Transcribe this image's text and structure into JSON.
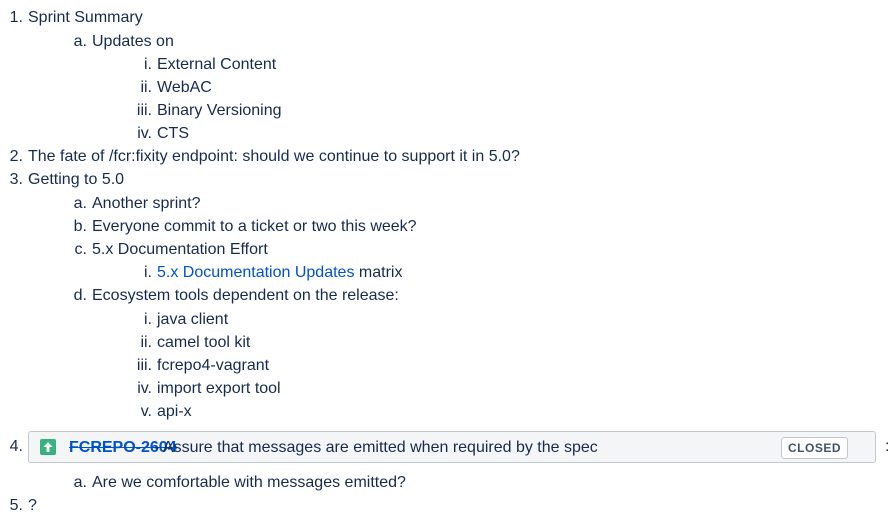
{
  "items": {
    "n1": "1.",
    "t1": "Sprint Summary",
    "n1a": "a.",
    "t1a": "Updates on",
    "n1ai": "i.",
    "t1ai": "External Content",
    "n1aii": "ii.",
    "t1aii": "WebAC",
    "n1aiii": "iii.",
    "t1aiii": "Binary Versioning",
    "n1aiv": "iv.",
    "t1aiv": "CTS",
    "n2": "2.",
    "t2": "The fate of /fcr:fixity  endpoint:  should we continue to support it in 5.0?",
    "n3": "3.",
    "t3": "Getting to 5.0",
    "n3a": "a.",
    "t3a": "Another sprint?",
    "n3b": "b.",
    "t3b": "Everyone commit to a ticket or two this week?",
    "n3c": "c.",
    "t3c": "5.x Documentation Effort",
    "n3ci": "i.",
    "t3ci_link": "5.x Documentation Updates",
    "t3ci_rest": " matrix",
    "n3d": "d.",
    "t3d": "Ecosystem tools dependent on the release:",
    "n3di": "i.",
    "t3di": "java client",
    "n3dii": "ii.",
    "t3dii": "camel tool kit",
    "n3diii": "iii.",
    "t3diii": "fcrepo4-vagrant",
    "n3div": "iv.",
    "t3div": "import export tool",
    "n3dv": "v.",
    "t3dv": "api-x",
    "n4": "4.",
    "n4a": "a.",
    "t4a": "Are we comfortable with messages emitted?",
    "n5": "5.",
    "t5": "?"
  },
  "jira": {
    "icon": "arrow-up-icon",
    "key": "FCREPO-2604",
    "summary": "- Assure that messages are emitted when required by the spec",
    "status": "CLOSED",
    "trailing": ":"
  },
  "colors": {
    "link": "#0052cc",
    "text": "#172b4d",
    "icon_bg": "#36b37e"
  }
}
